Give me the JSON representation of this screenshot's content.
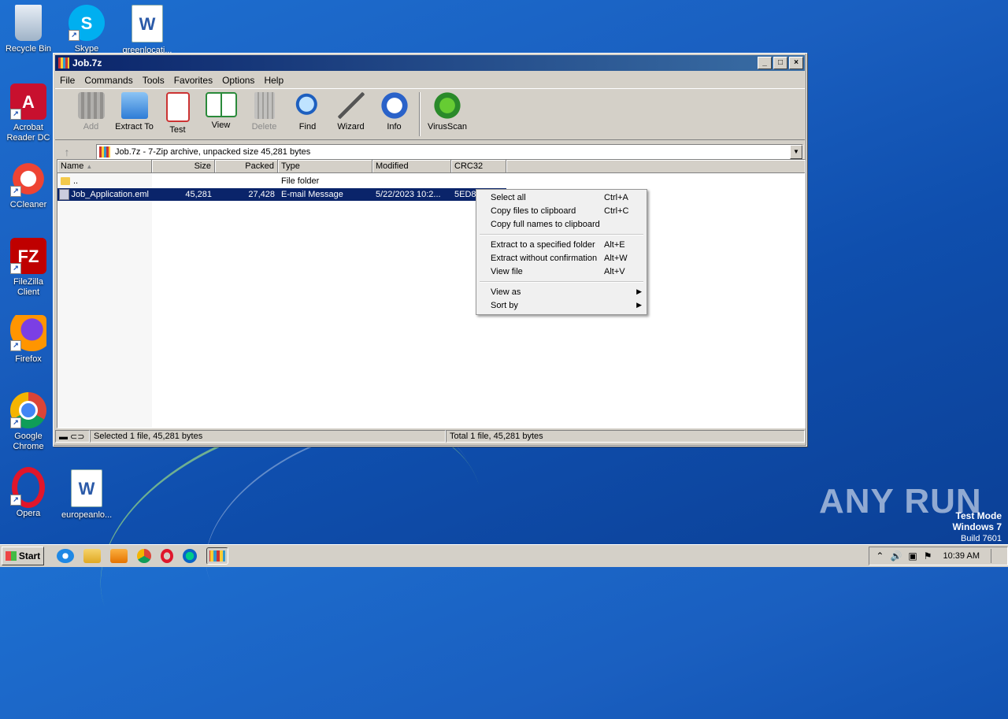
{
  "desktop": {
    "icons": [
      {
        "label": "Recycle Bin"
      },
      {
        "label": "Skype"
      },
      {
        "label": "greenlocati..."
      },
      {
        "label": "Acrobat Reader DC"
      },
      {
        "label": "CCleaner"
      },
      {
        "label": "FileZilla Client"
      },
      {
        "label": "Firefox"
      },
      {
        "label": "Google Chrome"
      },
      {
        "label": "Opera"
      },
      {
        "label": "europeanlo..."
      }
    ],
    "watermark": {
      "brand": "ANY RUN",
      "line1": "Test Mode",
      "line2": "Windows 7",
      "line3": "Build 7601"
    }
  },
  "window": {
    "title": "Job.7z",
    "menu": [
      "File",
      "Commands",
      "Tools",
      "Favorites",
      "Options",
      "Help"
    ],
    "toolbar": [
      {
        "label": "Add",
        "disabled": true,
        "icon": "add-icon"
      },
      {
        "label": "Extract To",
        "disabled": false,
        "icon": "folder-icon"
      },
      {
        "label": "Test",
        "disabled": false,
        "icon": "test-icon"
      },
      {
        "label": "View",
        "disabled": false,
        "icon": "book-icon"
      },
      {
        "label": "Delete",
        "disabled": true,
        "icon": "trash-icon"
      },
      {
        "label": "Find",
        "disabled": false,
        "icon": "magnifier-icon"
      },
      {
        "label": "Wizard",
        "disabled": false,
        "icon": "wand-icon"
      },
      {
        "label": "Info",
        "disabled": false,
        "icon": "info-icon"
      },
      {
        "label": "VirusScan",
        "disabled": false,
        "icon": "bug-icon"
      }
    ],
    "address": "Job.7z - 7-Zip archive, unpacked size 45,281 bytes",
    "columns": [
      "Name",
      "Size",
      "Packed",
      "Type",
      "Modified",
      "CRC32"
    ],
    "rows": [
      {
        "name": "..",
        "size": "",
        "packed": "",
        "type": "File folder",
        "modified": "",
        "crc": ""
      },
      {
        "name": "Job_Application.eml",
        "size": "45,281",
        "packed": "27,428",
        "type": "E-mail Message",
        "modified": "5/22/2023 10:2...",
        "crc": "5ED8"
      }
    ],
    "status_left": "Selected 1 file, 45,281 bytes",
    "status_right": "Total 1 file, 45,281 bytes"
  },
  "context_menu": {
    "items": [
      {
        "label": "Select all",
        "key": "Ctrl+A"
      },
      {
        "label": "Copy files to clipboard",
        "key": "Ctrl+C"
      },
      {
        "label": "Copy full names to clipboard",
        "key": ""
      },
      {
        "label": "Extract to a specified folder",
        "key": "Alt+E"
      },
      {
        "label": "Extract without confirmation",
        "key": "Alt+W"
      },
      {
        "label": "View file",
        "key": "Alt+V"
      },
      {
        "label": "View as",
        "key": ""
      },
      {
        "label": "Sort by",
        "key": ""
      }
    ]
  },
  "taskbar": {
    "start_label": "Start",
    "clock": "10:39 AM"
  }
}
